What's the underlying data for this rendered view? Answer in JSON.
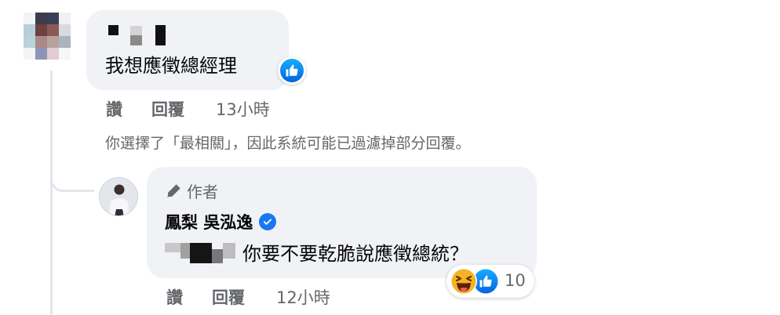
{
  "comment": {
    "text": "我想應徵總經理",
    "actions": {
      "like": "讚",
      "reply": "回覆",
      "time": "13小時"
    }
  },
  "filter_notice": "你選擇了「最相關」，因此系統可能已過濾掉部分回覆。",
  "reply": {
    "author_badge": "作者",
    "author_name": "鳳梨 吳泓逸",
    "text": "你要不要乾脆說應徵總統？",
    "reaction_count": "10",
    "actions": {
      "like": "讚",
      "reply": "回覆",
      "time": "12小時"
    }
  },
  "icons": {
    "like": "thumbs-up-icon",
    "haha": "laughing-face-icon",
    "pen": "pen-icon",
    "verified": "verified-check-icon"
  },
  "colors": {
    "bubble": "#f0f2f5",
    "secondary_text": "#65676b",
    "like_blue": "#1877f2",
    "haha_yellow": "#f7b125"
  }
}
